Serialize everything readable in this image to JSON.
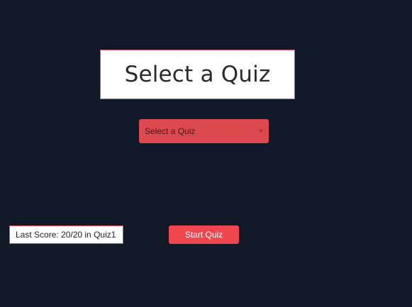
{
  "header": {
    "title": "Select a Quiz"
  },
  "quiz_select": {
    "selected": "Select a Quiz"
  },
  "footer": {
    "last_score": "Last Score: 20/20 in Quiz1",
    "start_label": "Start Quiz"
  },
  "colors": {
    "background": "#111827",
    "accent": "#f0474f",
    "select_bg": "#dc4a4f",
    "border": "#e0505a"
  },
  "icons": {
    "select_arrow": "chevron-down-icon"
  }
}
